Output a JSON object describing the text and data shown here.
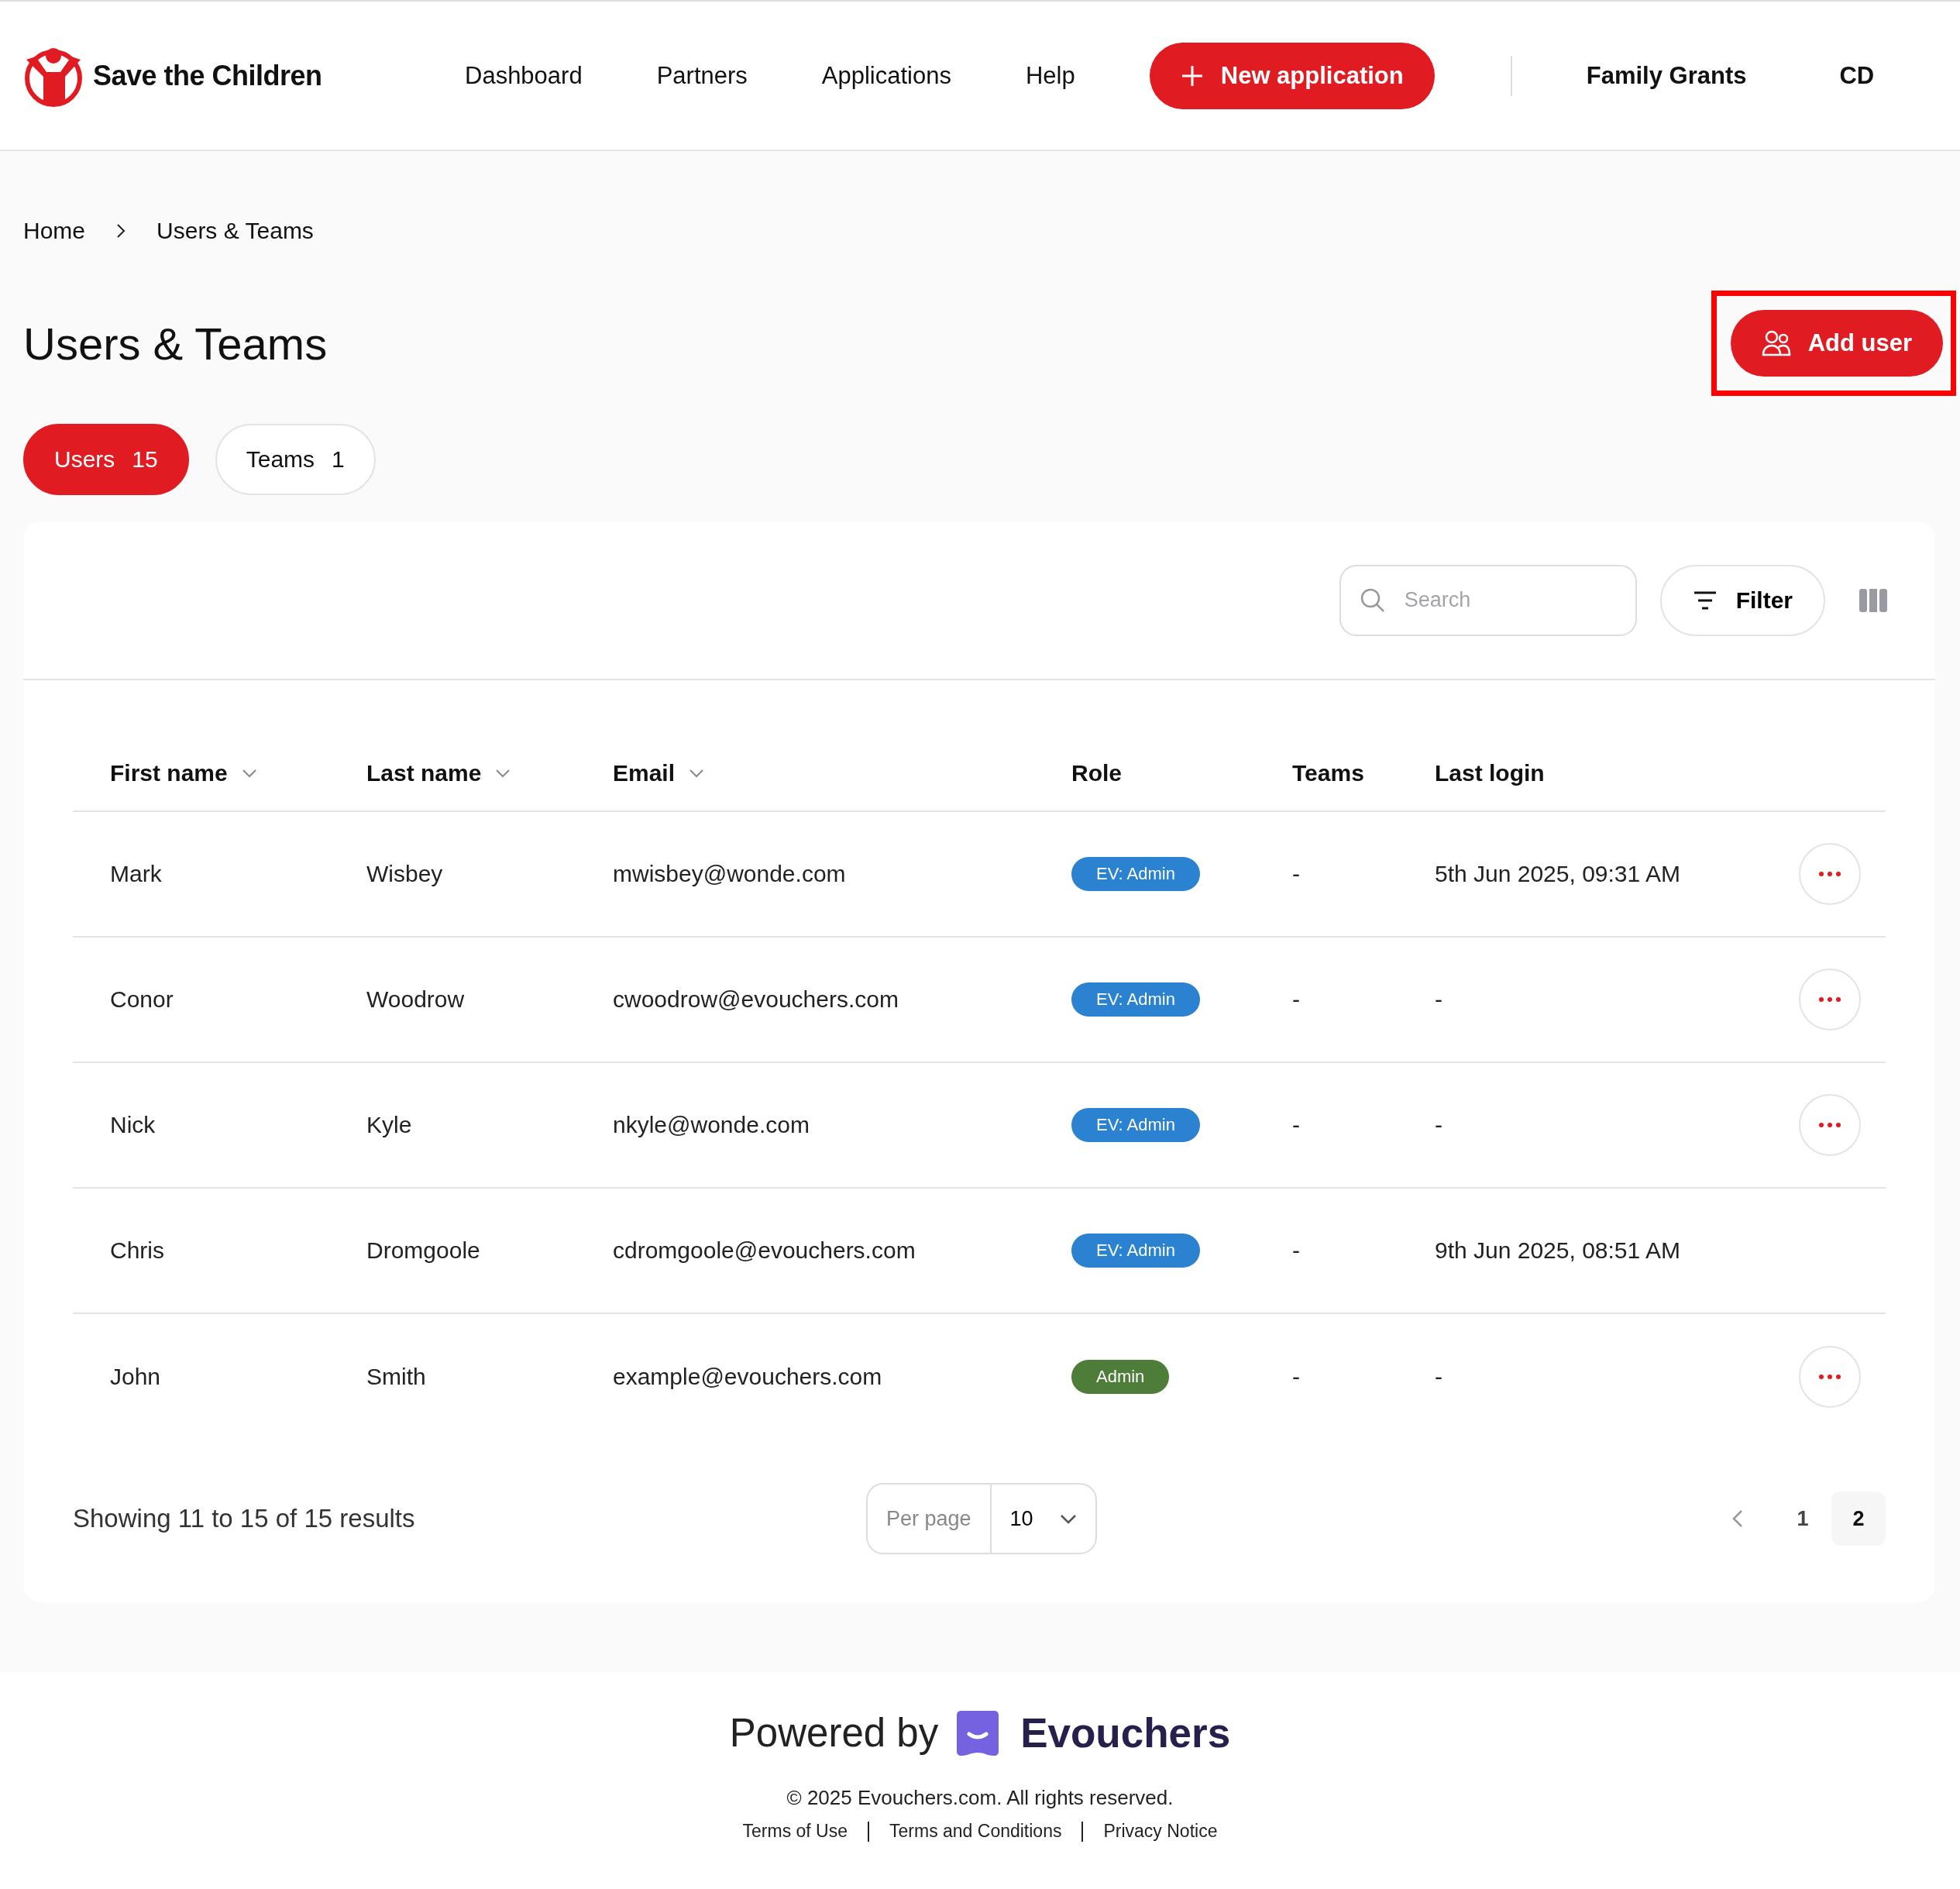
{
  "header": {
    "brand": "Save the Children",
    "nav": [
      {
        "label": "Dashboard",
        "selected": false
      },
      {
        "label": "Partners",
        "selected": false
      },
      {
        "label": "Applications",
        "selected": false
      },
      {
        "label": "Help",
        "selected": false
      }
    ],
    "new_button": "New application",
    "organisation": "Family Grants",
    "user_initials": "CD"
  },
  "breadcrumb": [
    "Home",
    "Users & Teams"
  ],
  "title": "Users & Teams",
  "add_button": {
    "label": "Add user",
    "highlighted": true
  },
  "tabs": [
    {
      "label": "Users",
      "count": "15",
      "selected": true
    },
    {
      "label": "Teams",
      "count": "1",
      "selected": false
    }
  ],
  "toolbar": {
    "search": {
      "placeholder": "Search"
    },
    "filter": "Filter"
  },
  "table": {
    "columns": [
      {
        "label": "First name",
        "sortable": true
      },
      {
        "label": "Last name",
        "sortable": true
      },
      {
        "label": "Email",
        "sortable": true
      },
      {
        "label": "Role",
        "sortable": false
      },
      {
        "label": "Teams",
        "sortable": false
      },
      {
        "label": "Last login",
        "sortable": false
      }
    ],
    "rows": [
      {
        "first": "Mark",
        "last": "Wisbey",
        "email": "mwisbey@wonde.com",
        "role": "EV: Admin",
        "color": "#2b82d0",
        "teams": "-",
        "last_login": "5th Jun 2025, 09:31 AM",
        "actions": true
      },
      {
        "first": "Conor",
        "last": "Woodrow",
        "email": "cwoodrow@evouchers.com",
        "role": "EV: Admin",
        "color": "#2b82d0",
        "teams": "-",
        "last_login": "-",
        "actions": true
      },
      {
        "first": "Nick",
        "last": "Kyle",
        "email": "nkyle@wonde.com",
        "role": "EV: Admin",
        "color": "#2b82d0",
        "teams": "-",
        "last_login": "-",
        "actions": true
      },
      {
        "first": "Chris",
        "last": "Dromgoole",
        "email": "cdromgoole@evouchers.com",
        "role": "EV: Admin",
        "color": "#2b82d0",
        "teams": "-",
        "last_login": "9th Jun 2025, 08:51 AM",
        "actions": false
      },
      {
        "first": "John",
        "last": "Smith",
        "email": "example@evouchers.com",
        "role": "Admin",
        "color": "#4e7d3a",
        "teams": "-",
        "last_login": "-",
        "actions": true
      }
    ]
  },
  "pagination": {
    "summary": "Showing 11 to 15 of 15 results",
    "per_page_label": "Per page",
    "per_page": "10",
    "pages": [
      {
        "label": "1",
        "selected": false
      },
      {
        "label": "2",
        "selected": true
      }
    ]
  },
  "footer": {
    "powered_by": "Powered by",
    "brand": "Evouchers",
    "copyright": "© 2025 Evouchers.com. All rights reserved.",
    "links": [
      "Terms of Use",
      "Terms and Conditions",
      "Privacy Notice"
    ]
  }
}
